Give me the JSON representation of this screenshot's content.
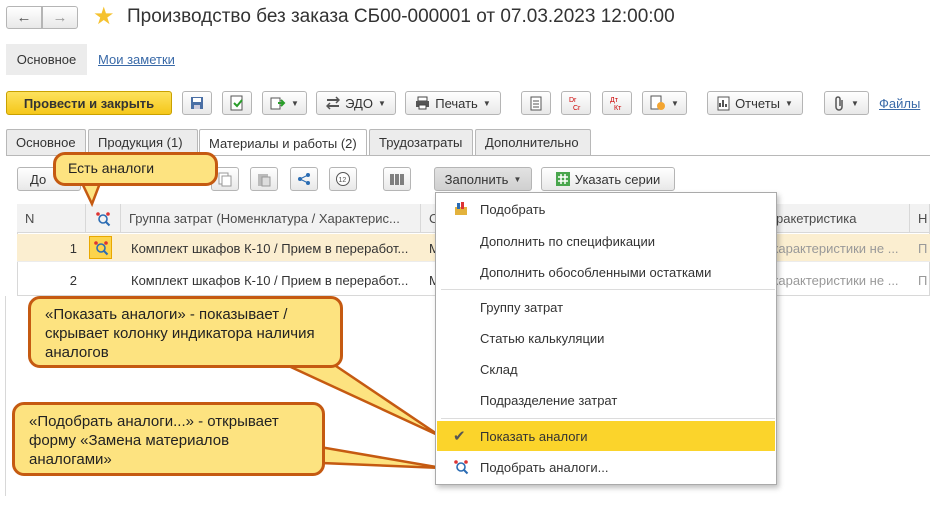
{
  "window": {
    "title": "Производство без заказа СБ00-000001 от 07.03.2023 12:00:00",
    "nav_back": "←",
    "nav_forward": "→",
    "star": "★"
  },
  "top_tabs": {
    "main": "Основное",
    "notes": "Мои заметки"
  },
  "toolbar": {
    "post_close": "Провести и закрыть",
    "edo": "ЭДО",
    "print": "Печать",
    "dt_label": "Дт",
    "kt_label": "Кт",
    "reports": "Отчеты",
    "files": "Файлы"
  },
  "doc_tabs": [
    "Основное",
    "Продукция (1)",
    "Материалы и работы (2)",
    "Трудозатраты",
    "Дополнительно"
  ],
  "table_toolbar": {
    "add": "До",
    "fill": "Заполнить",
    "series": "Указать серии"
  },
  "table": {
    "headers": {
      "n": "N",
      "group": "Группа затрат (Номенклатура / Характерис...",
      "col4": "С",
      "char": "ракетристика",
      "col6": "Н"
    },
    "rows": [
      {
        "n": "1",
        "group": "Комплект шкафов К-10 / Прием в переработ...",
        "col4": "М",
        "char": "характеристики не ...",
        "col6": "П"
      },
      {
        "n": "2",
        "group": "Комплект шкафов К-10 / Прием в переработ...",
        "col4": "М",
        "char": "характеристики не ...",
        "col6": "П"
      }
    ]
  },
  "menu": {
    "items": [
      "Подобрать",
      "Дополнить по спецификации",
      "Дополнить обособленными остатками",
      "Группу затрат",
      "Статью калькуляции",
      "Склад",
      "Подразделение затрат",
      "Показать аналоги",
      "Подобрать аналоги..."
    ],
    "checkmark": "✔"
  },
  "callouts": {
    "analogs": "Есть аналоги",
    "show": "«Показать аналоги» - показывает / скрывает колонку индикатора наличия аналогов",
    "pick": "«Подобрать аналоги...» - открывает форму «Замена материалов аналогами»"
  },
  "colors": {
    "accent_yellow": "#fbd42b",
    "callout_fill": "#fde380",
    "callout_border": "#c55a11",
    "link": "#3a6aa8",
    "row_highlight": "#fbeed0"
  }
}
